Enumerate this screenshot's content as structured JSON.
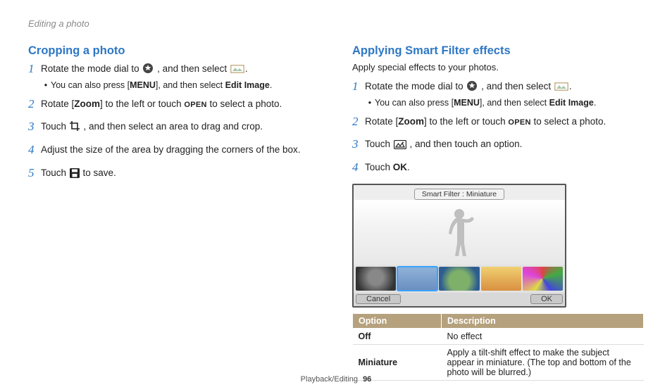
{
  "header": {
    "title": "Editing a photo"
  },
  "footer": {
    "section": "Playback/Editing",
    "page": "96"
  },
  "left": {
    "title": "Cropping a photo",
    "steps": [
      {
        "num": "1",
        "pre": "Rotate the mode dial to ",
        "mid": " , and then select ",
        "post": ".",
        "sub_pre": "You can also press [",
        "sub_menu": "MENU",
        "sub_mid": "], and then select ",
        "sub_bold": "Edit Image",
        "sub_post": "."
      },
      {
        "num": "2",
        "pre": "Rotate [",
        "bold": "Zoom",
        "mid": "] to the left or touch ",
        "open": "OPEN",
        "post": " to select a photo."
      },
      {
        "num": "3",
        "pre": "Touch ",
        "post": " , and then select an area to drag and crop."
      },
      {
        "num": "4",
        "text": "Adjust the size of the area by dragging the corners of the box."
      },
      {
        "num": "5",
        "pre": "Touch ",
        "post": " to save."
      }
    ]
  },
  "right": {
    "title": "Applying Smart Filter effects",
    "subtitle": "Apply special effects to your photos.",
    "steps": [
      {
        "num": "1",
        "pre": "Rotate the mode dial to ",
        "mid": " , and then select ",
        "post": ".",
        "sub_pre": "You can also press [",
        "sub_menu": "MENU",
        "sub_mid": "], and then select ",
        "sub_bold": "Edit Image",
        "sub_post": "."
      },
      {
        "num": "2",
        "pre": "Rotate [",
        "bold": "Zoom",
        "mid": "] to the left or touch ",
        "open": "OPEN",
        "post": " to select a photo."
      },
      {
        "num": "3",
        "pre": "Touch ",
        "post": " , and then touch an option."
      },
      {
        "num": "4",
        "pre": "Touch ",
        "ok": "OK",
        "post": "."
      }
    ],
    "screenshot": {
      "title": "Smart Filter : Miniature",
      "cancel": "Cancel",
      "ok": "OK"
    },
    "table": {
      "head_option": "Option",
      "head_desc": "Description",
      "rows": [
        {
          "name": "Off",
          "desc": "No effect"
        },
        {
          "name": "Miniature",
          "desc": "Apply a tilt-shift effect to make the subject appear in miniature. (The top and bottom of the photo will be blurred.)"
        }
      ]
    }
  }
}
